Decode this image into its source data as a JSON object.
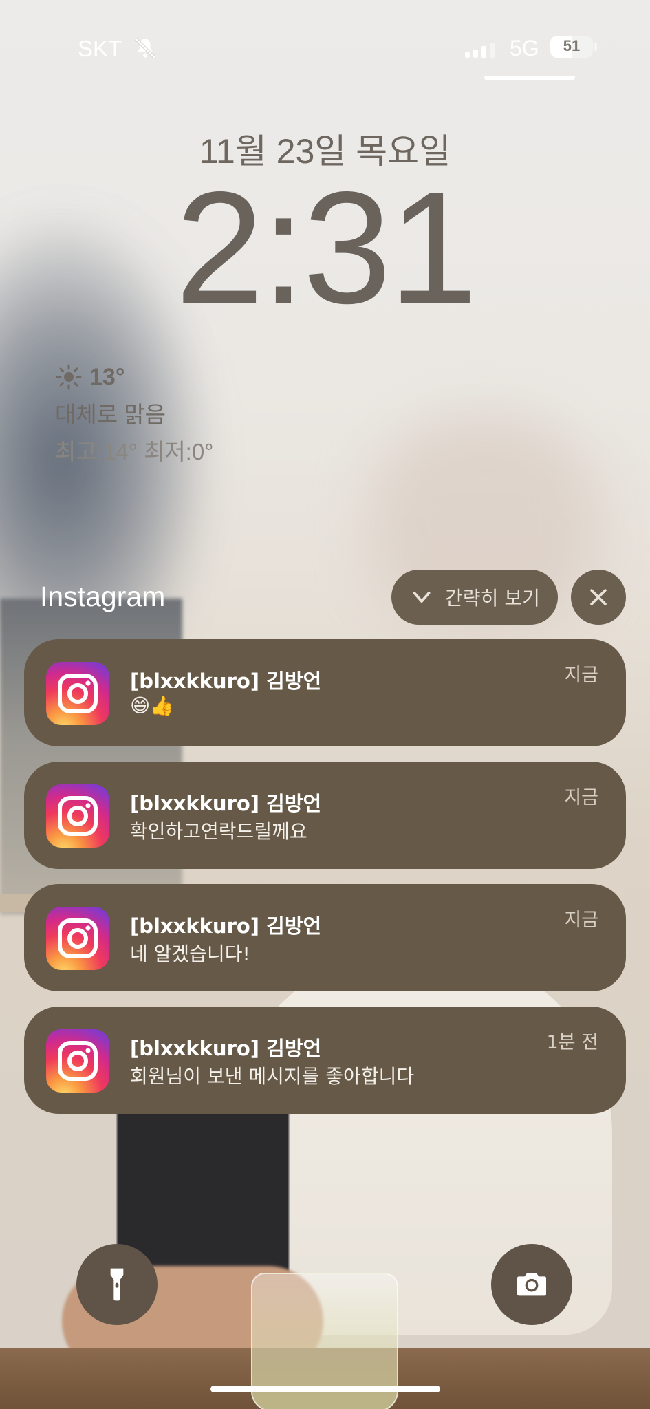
{
  "status_bar": {
    "carrier": "SKT",
    "silent_icon": "bell-slash-icon",
    "signal_bars": 3,
    "network": "5G",
    "battery_percent": "51"
  },
  "lockscreen": {
    "date": "11월 23일 목요일",
    "time": "2:31"
  },
  "weather": {
    "icon": "sun-icon",
    "temperature": "13°",
    "condition": "대체로 맑음",
    "range": "최고:14° 최저:0°"
  },
  "notification_group": {
    "app_name": "Instagram",
    "collapse_label": "간략히 보기",
    "collapse_icon": "chevron-down-icon",
    "close_icon": "close-icon"
  },
  "notifications": [
    {
      "title": "[blxxkkuro] 김방언",
      "body": "😄👍",
      "time": "지금"
    },
    {
      "title": "[blxxkkuro] 김방언",
      "body": "확인하고연락드릴께요",
      "time": "지금"
    },
    {
      "title": "[blxxkkuro] 김방언",
      "body": "네 알겠습니다!",
      "time": "지금"
    },
    {
      "title": "[blxxkkuro] 김방언",
      "body": "회원님이 보낸 메시지를 좋아합니다",
      "time": "1분 전"
    }
  ],
  "quick_actions": {
    "left_icon": "flashlight-icon",
    "right_icon": "camera-icon"
  },
  "colors": {
    "notification_bg": "#665947",
    "button_bg": "#6b5f4f"
  }
}
